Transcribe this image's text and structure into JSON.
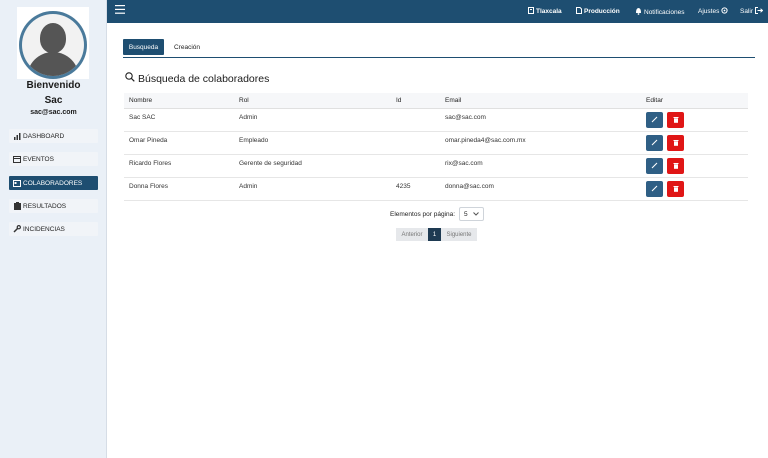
{
  "sidebar": {
    "welcome": "Bienvenido",
    "user_name": "Sac",
    "user_email": "sac@sac.com",
    "items": [
      {
        "label": "DASHBOARD",
        "icon": "bar-chart-icon"
      },
      {
        "label": "EVENTOS",
        "icon": "calendar-icon"
      },
      {
        "label": "COLABORADORES",
        "icon": "id-card-icon",
        "active": true
      },
      {
        "label": "RESULTADOS",
        "icon": "clipboard-icon"
      },
      {
        "label": "INCIDENCIAS",
        "icon": "wrench-icon"
      }
    ]
  },
  "topbar": {
    "menu_icon": "hamburger-icon",
    "tlaxcala": "Tlaxcala",
    "produccion": "Producción",
    "notificaciones": "Notificaciones",
    "ajustes": "Ajustes",
    "salir": "Salir"
  },
  "tabs": {
    "busqueda": "Busqueda",
    "creacion": "Creación"
  },
  "section_title": "Búsqueda de colaboradores",
  "table": {
    "headers": [
      "Nombre",
      "Rol",
      "Id",
      "Email",
      "Editar"
    ],
    "rows": [
      {
        "nombre": "Sac SAC",
        "rol": "Admin",
        "id": "",
        "email": "sac@sac.com"
      },
      {
        "nombre": "Omar Pineda",
        "rol": "Empleado",
        "id": "",
        "email": "omar.pineda4@sac.com.mx"
      },
      {
        "nombre": "Ricardo Flores",
        "rol": "Gerente de seguridad",
        "id": "",
        "email": "rix@sac.com"
      },
      {
        "nombre": "Donna Flores",
        "rol": "Admin",
        "id": "4235",
        "email": "donna@sac.com"
      }
    ]
  },
  "pagination": {
    "per_page_label": "Elementos por página:",
    "per_page_value": "5",
    "prev": "Anterior",
    "current": "1",
    "next": "Siguiente"
  },
  "colors": {
    "primary": "#1e4e71",
    "danger": "#e01616",
    "sidebar_bg": "#eaf0f7"
  }
}
